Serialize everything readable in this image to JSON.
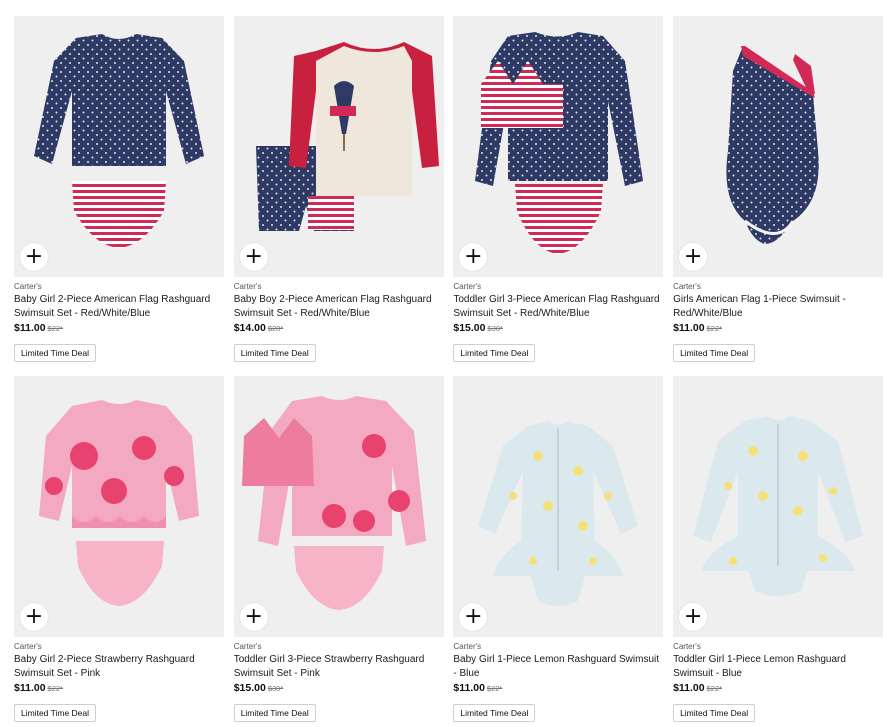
{
  "products": [
    {
      "brand": "Carter's",
      "title": "Baby Girl 2-Piece American Flag Rashguard Swimsuit Set - Red/White/Blue",
      "price": "$11.00",
      "old_price": "$22*",
      "deal": "Limited Time Deal",
      "image": "navy-rashguard-striped-bottom"
    },
    {
      "brand": "Carter's",
      "title": "Baby Boy 2-Piece American Flag Rashguard Swimsuit Set - Red/White/Blue",
      "price": "$14.00",
      "old_price": "$28*",
      "deal": "Limited Time Deal",
      "image": "red-white-cool-rashguard-trunks"
    },
    {
      "brand": "Carter's",
      "title": "Toddler Girl 3-Piece American Flag Rashguard Swimsuit Set - Red/White/Blue",
      "price": "$15.00",
      "old_price": "$30*",
      "deal": "Limited Time Deal",
      "image": "navy-rashguard-bikini-set"
    },
    {
      "brand": "Carter's",
      "title": "Girls American Flag 1-Piece Swimsuit - Red/White/Blue",
      "price": "$11.00",
      "old_price": "$22*",
      "deal": "Limited Time Deal",
      "image": "navy-one-shoulder-swimsuit"
    },
    {
      "brand": "Carter's",
      "title": "Baby Girl 2-Piece Strawberry Rashguard Swimsuit Set - Pink",
      "price": "$11.00",
      "old_price": "$22*",
      "deal": "Limited Time Deal",
      "image": "pink-strawberry-rashguard-set"
    },
    {
      "brand": "Carter's",
      "title": "Toddler Girl 3-Piece Strawberry Rashguard Swimsuit Set - Pink",
      "price": "$15.00",
      "old_price": "$30*",
      "deal": "Limited Time Deal",
      "image": "pink-strawberry-3piece-set"
    },
    {
      "brand": "Carter's",
      "title": "Baby Girl 1-Piece Lemon Rashguard Swimsuit - Blue",
      "price": "$11.00",
      "old_price": "$22*",
      "deal": "Limited Time Deal",
      "image": "lemon-rashguard-romper"
    },
    {
      "brand": "Carter's",
      "title": "Toddler Girl 1-Piece Lemon Rashguard Swimsuit - Blue",
      "price": "$11.00",
      "old_price": "$22*",
      "deal": "Limited Time Deal",
      "image": "lemon-rashguard-suit"
    }
  ],
  "add_icon": "plus-icon",
  "colors": {
    "navy": "#2e3a63",
    "red": "#d22a56",
    "pink": "#f2a7c0",
    "strawberry": "#e8436f",
    "lemon_bg": "#dbe9ef",
    "lemon": "#f6e07a",
    "tile_bg": "#efefef"
  }
}
